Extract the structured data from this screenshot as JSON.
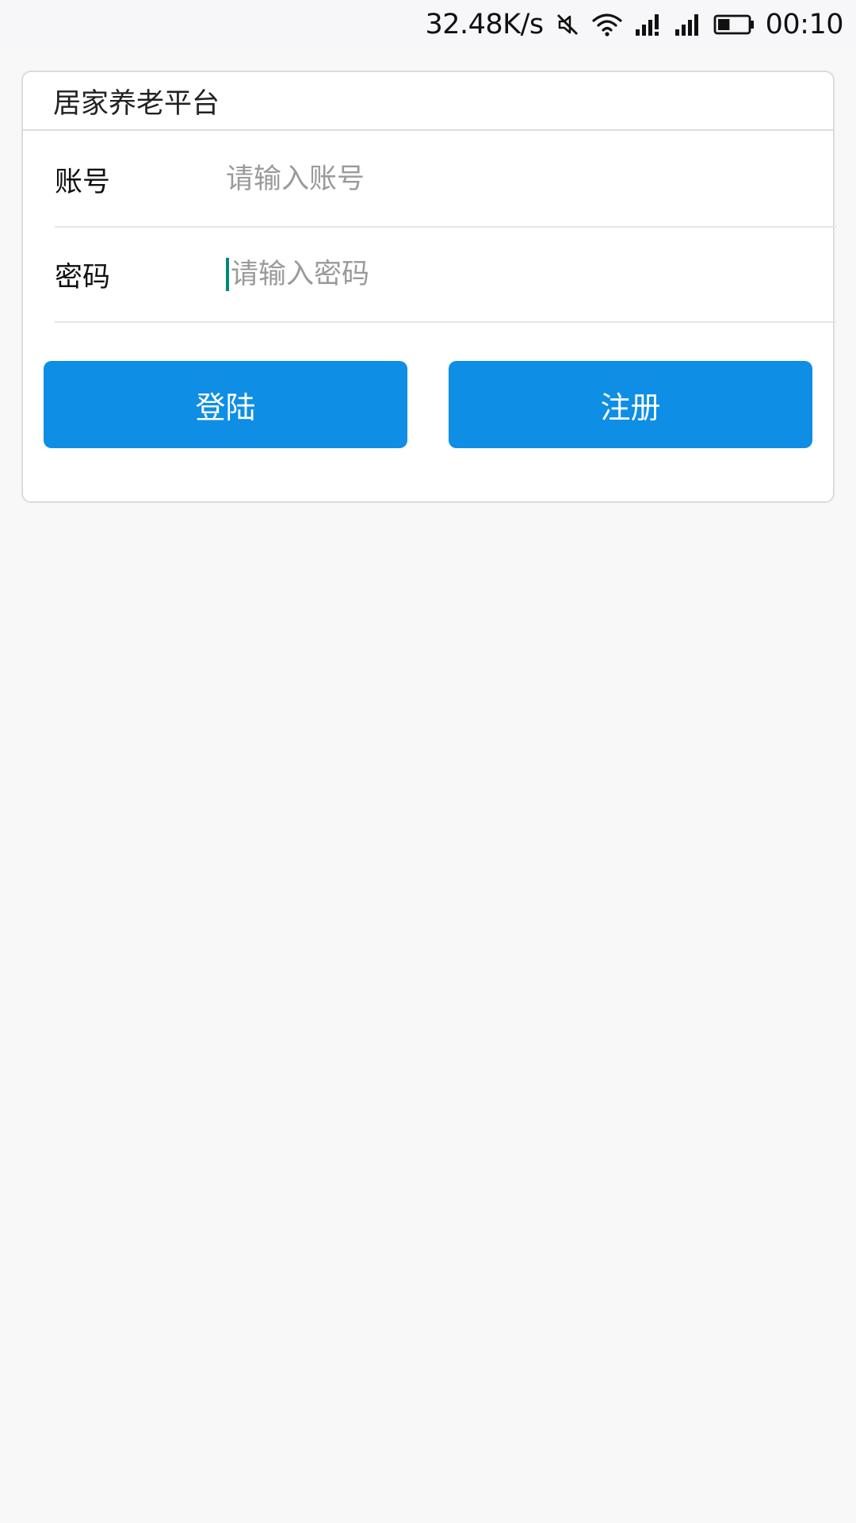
{
  "status_bar": {
    "net_speed": "32.48K/s",
    "time": "00:10",
    "icons": [
      "mute-icon",
      "wifi-icon",
      "signal-icon",
      "signal-icon",
      "battery-icon"
    ],
    "battery_level": 0.4
  },
  "app": {
    "title": "居家养老平台"
  },
  "form": {
    "account": {
      "label": "账号",
      "placeholder": "请输入账号",
      "value": ""
    },
    "password": {
      "label": "密码",
      "placeholder": "请输入密码",
      "value": ""
    }
  },
  "buttons": {
    "login_label": "登陆",
    "register_label": "注册"
  },
  "colors": {
    "primary": "#0e8ee5",
    "caret": "#00897b",
    "background": "#f8f8f8",
    "card_border": "#dcdcdc"
  }
}
